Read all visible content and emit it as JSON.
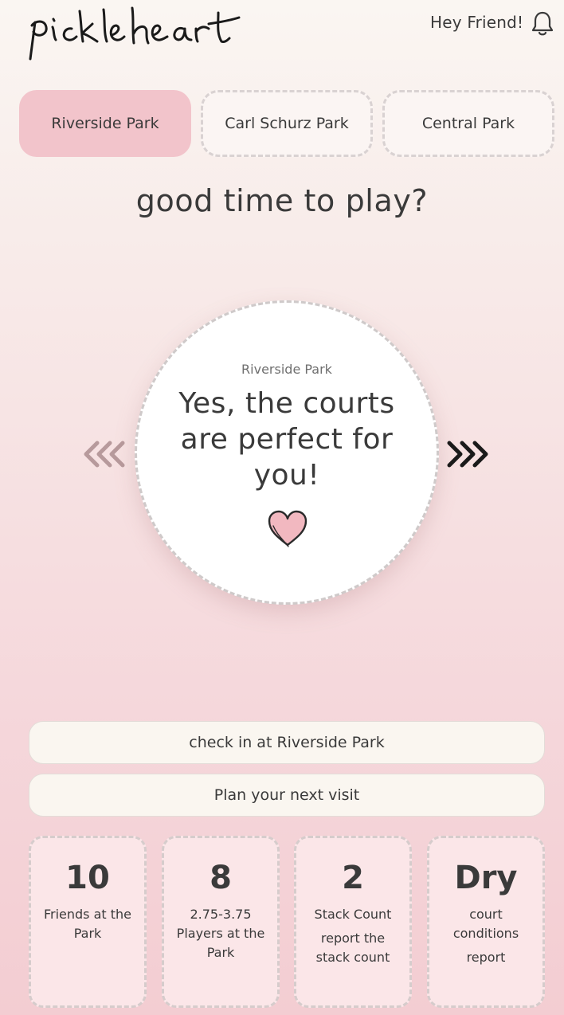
{
  "header": {
    "logo_text": "pickleheart",
    "greeting": "Hey Friend!",
    "bell_icon": "bell-icon"
  },
  "tabs": [
    {
      "label": "Riverside Park",
      "active": true
    },
    {
      "label": "Carl Schurz Park",
      "active": false
    },
    {
      "label": "Central Park",
      "active": false
    }
  ],
  "question": "good time to play?",
  "status_card": {
    "park": "Riverside Park",
    "message": "Yes, the courts are perfect for you!",
    "icon": "heart-icon"
  },
  "nav": {
    "prev_icon": "chevron-left-icon",
    "next_icon": "chevron-right-icon"
  },
  "actions": {
    "checkin_label": "check in at Riverside Park",
    "plan_label": "Plan your next visit"
  },
  "stats": [
    {
      "value": "10",
      "label": "Friends at the Park",
      "link": ""
    },
    {
      "value": "8",
      "label": "2.75-3.75 Players at the Park",
      "link": ""
    },
    {
      "value": "2",
      "label": "Stack Count",
      "link": "report the stack count"
    },
    {
      "value": "Dry",
      "label": "court conditions",
      "link": "report"
    }
  ],
  "colors": {
    "accent_pink": "#f2c4cb",
    "heart_fill": "#f2b8c0",
    "background_top": "#faf6f2",
    "background_bottom": "#f3cdd2"
  }
}
